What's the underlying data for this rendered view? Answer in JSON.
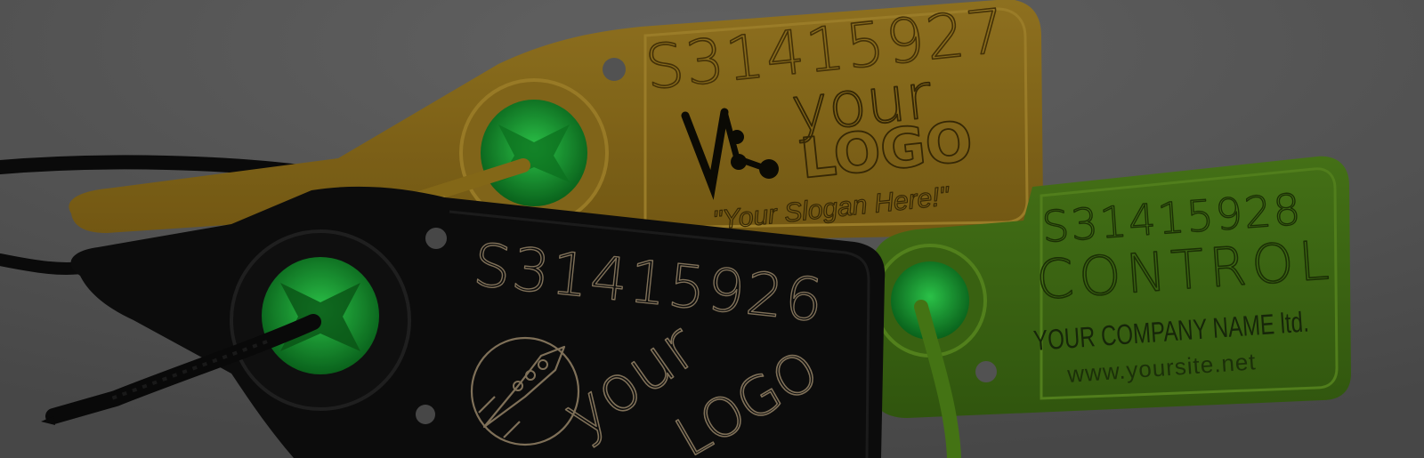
{
  "colors": {
    "background": "#5f5f5f",
    "yellow_tag": "#8a6c1a",
    "green_tag": "#3f6a14",
    "black_tag": "#0d0d0d",
    "window_green": "#1fae3a"
  },
  "tags": {
    "yellow": {
      "serial": "S31415927",
      "logo_word_1": "your",
      "logo_word_2": "LOGO",
      "slogan": "\"Your Slogan Here!\""
    },
    "green": {
      "serial": "S31415928",
      "headline": "CONTROL",
      "company": "YOUR COMPANY NAME ltd.",
      "website": "www.yoursite.net"
    },
    "black": {
      "serial": "S31415926",
      "logo_word_1": "your",
      "logo_word_2": "LOGO"
    }
  },
  "icons": {
    "yellow_logo": "molecule-logo-icon",
    "black_logo": "rocket-logo-icon"
  }
}
